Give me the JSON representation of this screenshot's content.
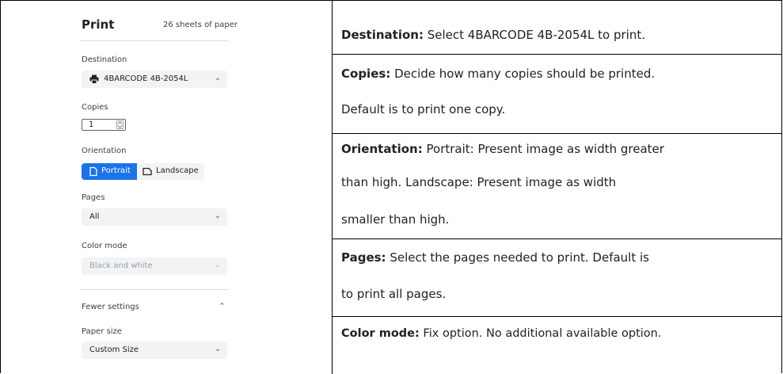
{
  "print_panel": {
    "title": "Print",
    "sheets": "26 sheets of paper",
    "destination": {
      "label": "Destination",
      "value": "4BARCODE 4B-2054L",
      "icon": "printer-icon"
    },
    "copies": {
      "label": "Copies",
      "value": "1"
    },
    "orientation": {
      "label": "Orientation",
      "portrait": "Portrait",
      "landscape": "Landscape",
      "selected": "Portrait"
    },
    "pages": {
      "label": "Pages",
      "value": "All"
    },
    "color_mode": {
      "label": "Color mode",
      "value": "Black and white",
      "disabled": true
    },
    "fewer_settings": "Fewer settings",
    "paper_size": {
      "label": "Paper size",
      "value": "Custom Size"
    }
  },
  "descriptions": {
    "destination": {
      "term": "Destination:",
      "text": " Select 4BARCODE 4B-2054L to print."
    },
    "copies": {
      "term": "Copies:",
      "text": " Decide how many copies should be printed.",
      "line2": "Default is to print one copy."
    },
    "orientation": {
      "term": "Orientation:",
      "text": " Portrait: Present image as width greater",
      "line2": "than high. Landscape: Present image as width",
      "line3": "smaller than high."
    },
    "pages": {
      "term": "Pages:",
      "text": " Select the pages needed to print. Default is",
      "line2": "to print all pages."
    },
    "color_mode": {
      "term": "Color mode:",
      "text": " Fix option. No additional available option."
    }
  },
  "colors": {
    "accent": "#1a73e8",
    "select_bg": "#f1f3f4",
    "border": "#000000"
  }
}
